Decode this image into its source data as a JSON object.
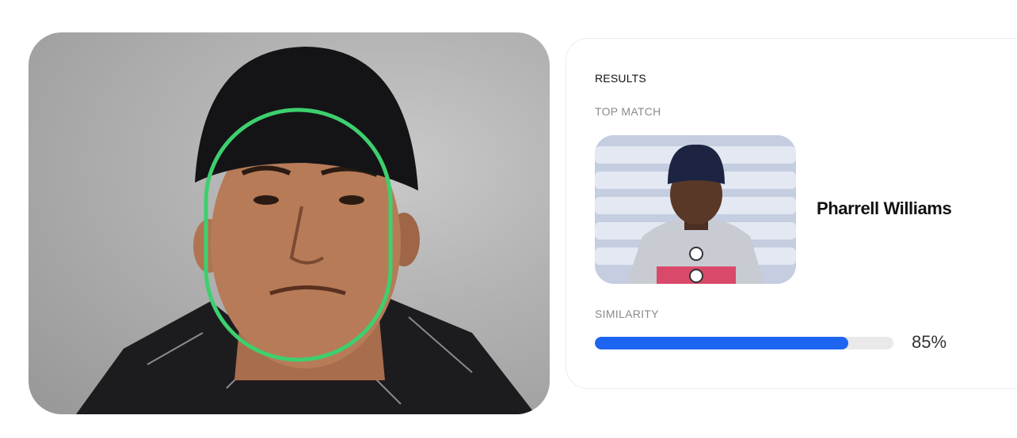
{
  "results": {
    "title": "RESULTS",
    "top_match_label": "TOP MATCH",
    "match_name": "Pharrell Williams",
    "similarity_label": "SIMILARITY",
    "similarity_value": 0.85,
    "similarity_text": "85%"
  },
  "colors": {
    "accent": "#1d64f0",
    "face_outline": "#3ecf6e"
  }
}
